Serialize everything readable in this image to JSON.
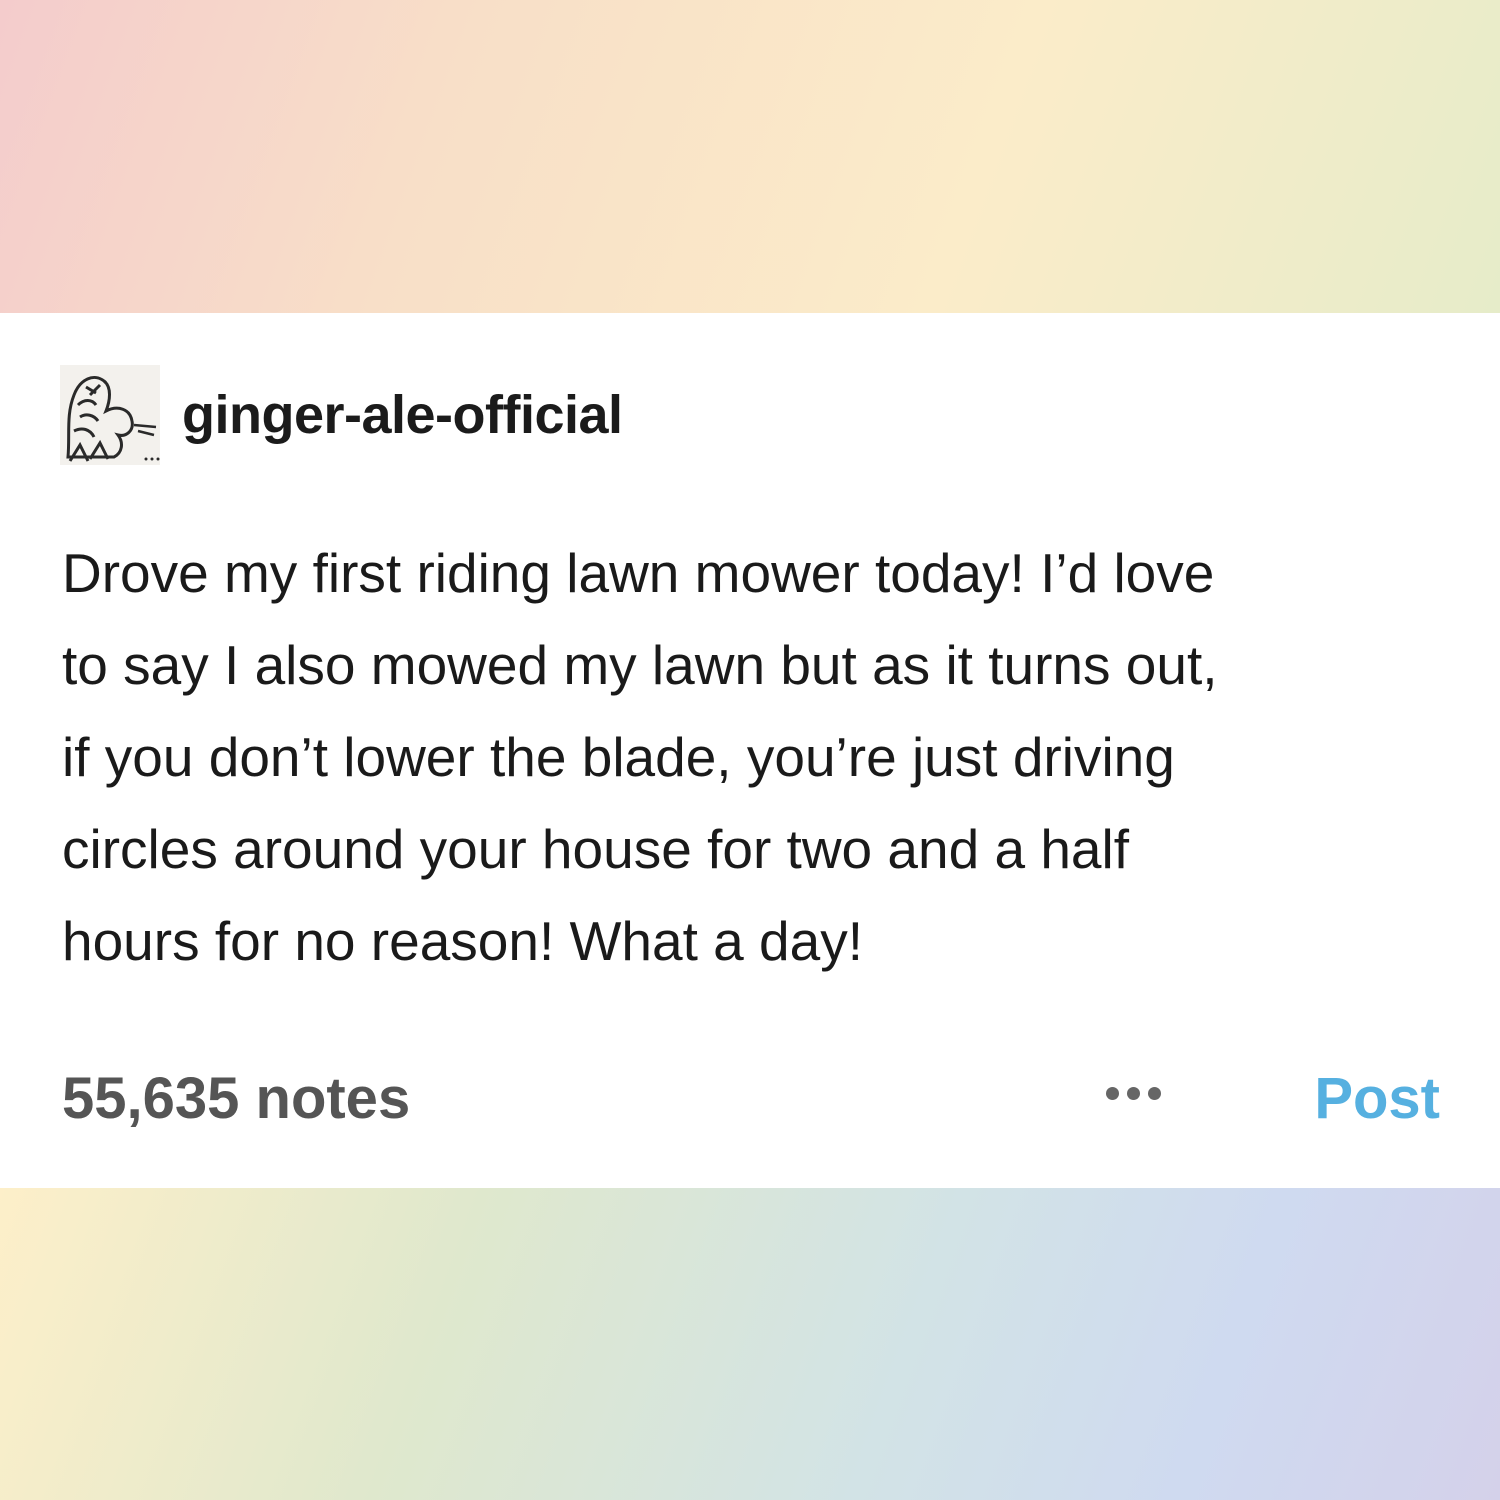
{
  "post": {
    "username": "ginger-ale-official",
    "avatar_icon": "sketch-illustration-avatar",
    "body_lines": [
      "Drove my first riding lawn mower today! I’d love",
      "to say I also mowed my lawn but as it turns out,",
      "if you don’t lower the blade, you’re just driving",
      "circles around your house for two and a half",
      "hours for no reason! What a day!"
    ],
    "notes": "55,635 notes",
    "more_icon": "ellipsis-icon",
    "action_label": "Post"
  },
  "colors": {
    "card_background": "#ffffff",
    "accent_link": "#56b0e0",
    "notes_text": "#555555"
  }
}
